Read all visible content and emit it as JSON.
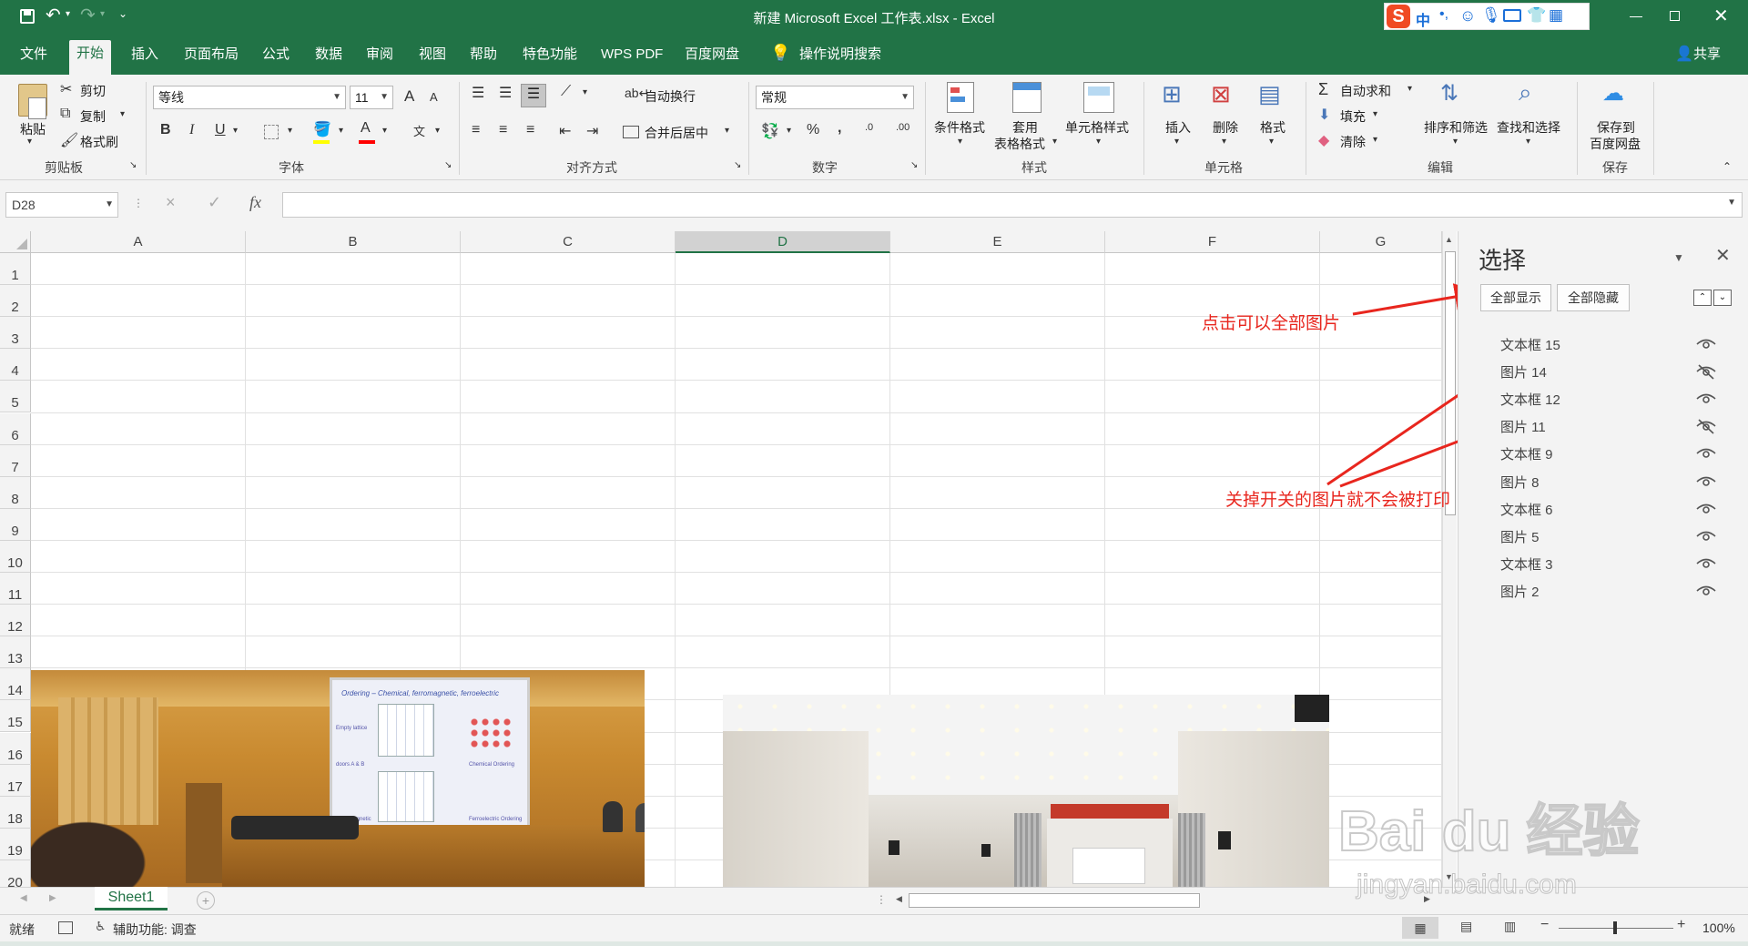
{
  "title": "新建 Microsoft Excel 工作表.xlsx  -  Excel",
  "ime": {
    "logo": "S",
    "lang": "中"
  },
  "menu": {
    "tabs": [
      "文件",
      "开始",
      "插入",
      "页面布局",
      "公式",
      "数据",
      "审阅",
      "视图",
      "帮助",
      "特色功能",
      "WPS PDF",
      "百度网盘"
    ],
    "active": "开始",
    "search": "操作说明搜索",
    "share": "共享"
  },
  "ribbon": {
    "clipboard": {
      "paste": "粘贴",
      "cut": "剪切",
      "copy": "复制",
      "painter": "格式刷",
      "label": "剪贴板"
    },
    "font": {
      "name": "等线",
      "size": "11",
      "label": "字体",
      "bold": "B",
      "italic": "I",
      "underline": "U",
      "grow": "A",
      "shrink": "A",
      "color": "A",
      "phonetic": "文"
    },
    "align": {
      "wrap": "自动换行",
      "merge": "合并后居中",
      "label": "对齐方式"
    },
    "number": {
      "format": "常规",
      "percent": "%",
      "comma": ",",
      "label": "数字"
    },
    "styles": {
      "cond": "条件格式",
      "table1": "套用",
      "table2": "表格格式",
      "cell": "单元格样式",
      "label": "样式"
    },
    "cells": {
      "insert": "插入",
      "delete": "删除",
      "format": "格式",
      "label": "单元格"
    },
    "edit": {
      "autosum": "自动求和",
      "fill": "填充",
      "clear": "清除",
      "sort": "排序和筛选",
      "find": "查找和选择",
      "label": "编辑"
    },
    "save": {
      "line1": "保存到",
      "line2": "百度网盘",
      "label": "保存"
    }
  },
  "formula": {
    "namebox": "D28",
    "cancel": "×",
    "enter": "✓",
    "fx": "fx"
  },
  "columns": [
    "A",
    "B",
    "C",
    "D",
    "E",
    "F",
    "G"
  ],
  "rows": [
    "1",
    "2",
    "3",
    "4",
    "5",
    "6",
    "7",
    "8",
    "9",
    "10",
    "11",
    "12",
    "13",
    "14",
    "15",
    "16",
    "17",
    "18",
    "19",
    "20"
  ],
  "pane": {
    "title": "选择",
    "show_all": "全部显示",
    "hide_all": "全部隐藏",
    "items": [
      {
        "name": "文本框 15",
        "visible": true
      },
      {
        "name": "图片 14",
        "visible": false
      },
      {
        "name": "文本框 12",
        "visible": true
      },
      {
        "name": "图片 11",
        "visible": false
      },
      {
        "name": "文本框 9",
        "visible": true
      },
      {
        "name": "图片 8",
        "visible": true
      },
      {
        "name": "文本框 6",
        "visible": true
      },
      {
        "name": "图片 5",
        "visible": true
      },
      {
        "name": "文本框 3",
        "visible": true
      },
      {
        "name": "图片 2",
        "visible": true
      }
    ]
  },
  "annotations": {
    "top": "点击可以全部图片",
    "bottom": "关掉开关的图片就不会被打印"
  },
  "slide_text": {
    "title": "Ordering – Chemical, ferromagnetic, ferroelectric",
    "empty": "Empty lattice",
    "doors": "doors A & B",
    "chem": "Chemical Ordering",
    "ferro": "Ferromagnetic",
    "ferroe": "Ferroelectric Ordering"
  },
  "sheet_tab": "Sheet1",
  "status": {
    "ready": "就绪",
    "accessibility": "辅助功能: 调查",
    "zoom": "100%"
  },
  "watermark": {
    "brand": "Bai du 经验",
    "url": "jingyan.baidu.com"
  },
  "colors": {
    "excel_green": "#217346",
    "annotation_red": "#e8261e"
  }
}
